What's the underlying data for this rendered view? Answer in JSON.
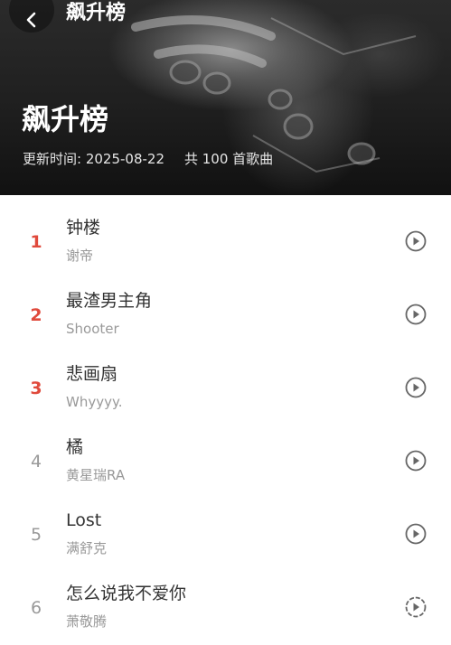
{
  "header": {
    "nav_title": "飙升榜",
    "title": "飙升榜",
    "update_label": "更新时间: 2025-08-22",
    "count_label": "共 100 首歌曲"
  },
  "songs": [
    {
      "rank": "1",
      "title": "钟楼",
      "artist": "谢帝",
      "highlight": true
    },
    {
      "rank": "2",
      "title": "最渣男主角",
      "artist": "Shooter",
      "highlight": true
    },
    {
      "rank": "3",
      "title": "悲画扇",
      "artist": "Whyyyy.",
      "highlight": true
    },
    {
      "rank": "4",
      "title": "橘",
      "artist": "黄星瑞RA",
      "highlight": false
    },
    {
      "rank": "5",
      "title": "Lost",
      "artist": "满舒克",
      "highlight": false
    },
    {
      "rank": "6",
      "title": "怎么说我不爱你",
      "artist": "萧敬腾",
      "highlight": false
    }
  ],
  "icons": {
    "back": "chevron-left-icon",
    "play": "play-circle-icon"
  },
  "colors": {
    "rank_highlight": "#e04a3c",
    "rank_normal": "#999999",
    "title_text": "#333333",
    "subtitle_text": "#999999",
    "play_icon": "#666666"
  }
}
